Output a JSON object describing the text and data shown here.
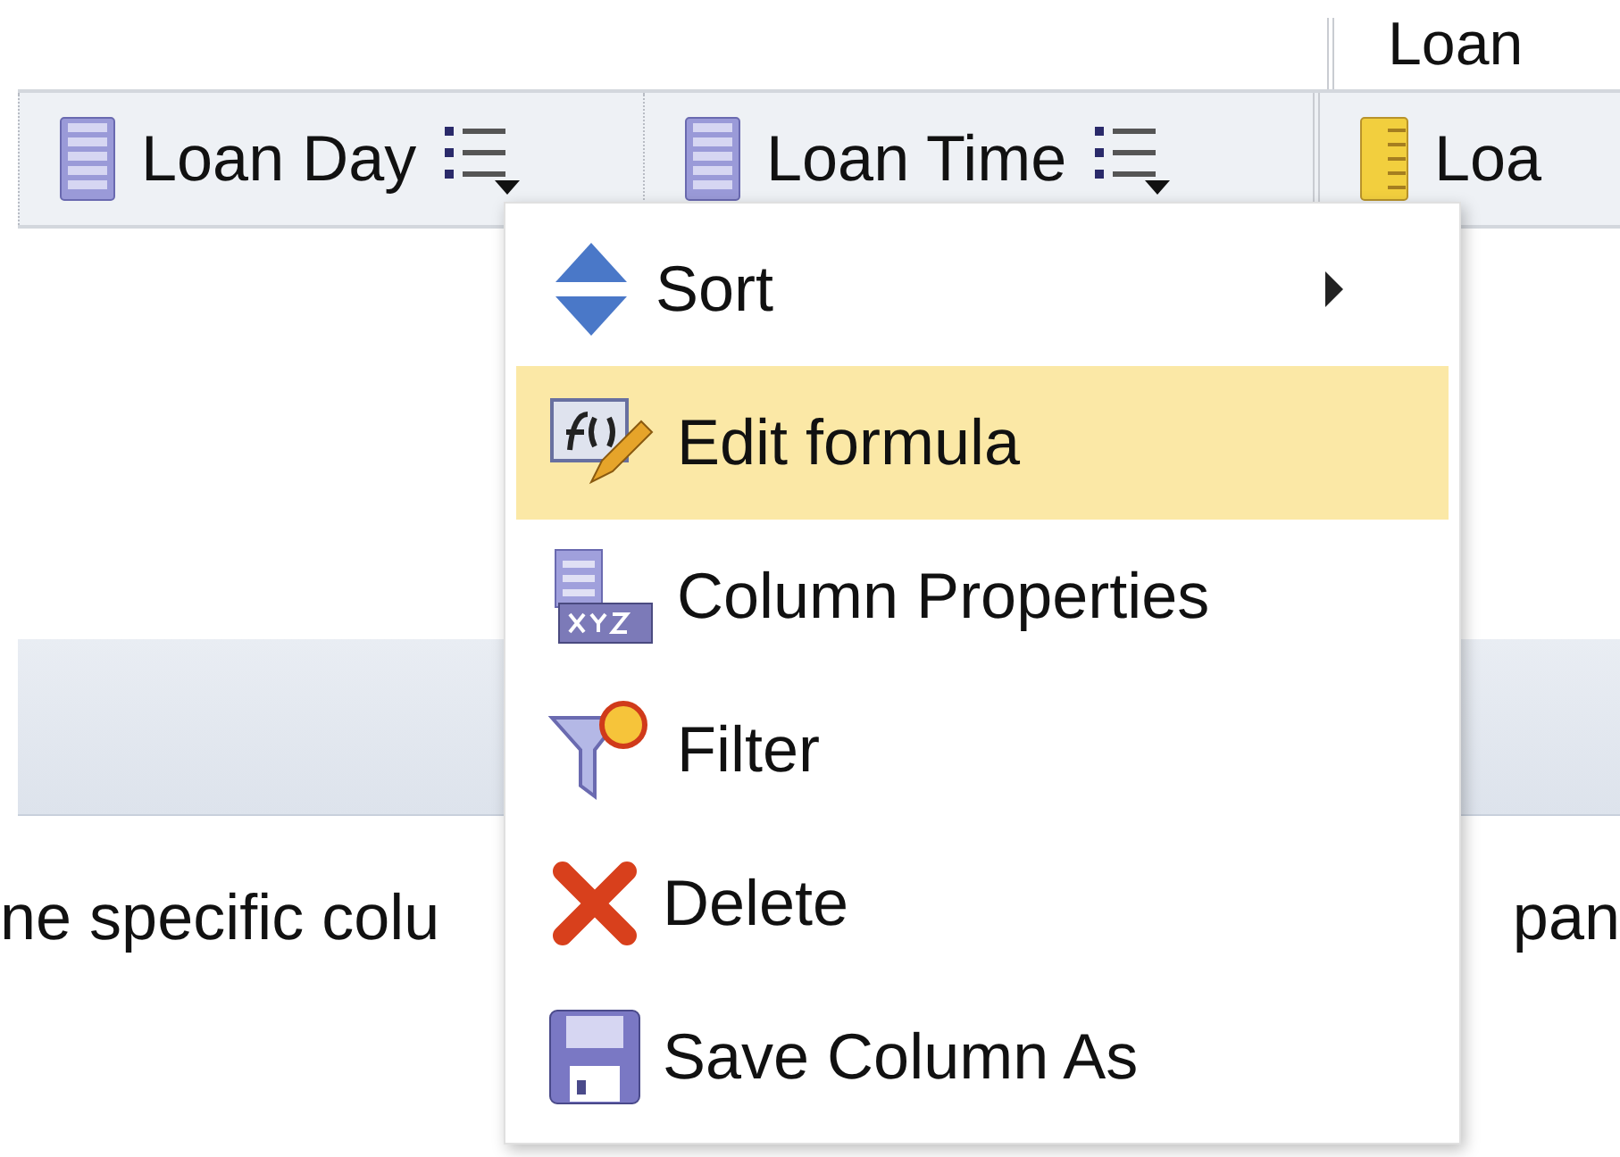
{
  "top_strip": {
    "label": "Loan"
  },
  "columns": [
    {
      "label": "Loan Day",
      "kind": "attribute",
      "menu_button": true
    },
    {
      "label": "Loan Time",
      "kind": "attribute",
      "menu_button": true
    },
    {
      "label": "Loa",
      "kind": "measure",
      "menu_button": false
    }
  ],
  "context_menu": [
    {
      "label": "Sort",
      "kind": "sort",
      "selected": false,
      "submenu": true
    },
    {
      "label": "Edit formula",
      "kind": "formula",
      "selected": true,
      "submenu": false
    },
    {
      "label": "Column Properties",
      "kind": "properties",
      "selected": false,
      "submenu": false
    },
    {
      "label": "Filter",
      "kind": "filter",
      "selected": false,
      "submenu": false
    },
    {
      "label": "Delete",
      "kind": "delete",
      "selected": false,
      "submenu": false
    },
    {
      "label": "Save Column As",
      "kind": "save",
      "selected": false,
      "submenu": false
    }
  ],
  "body_text": {
    "left": "ne specific colu",
    "right": "pan"
  }
}
